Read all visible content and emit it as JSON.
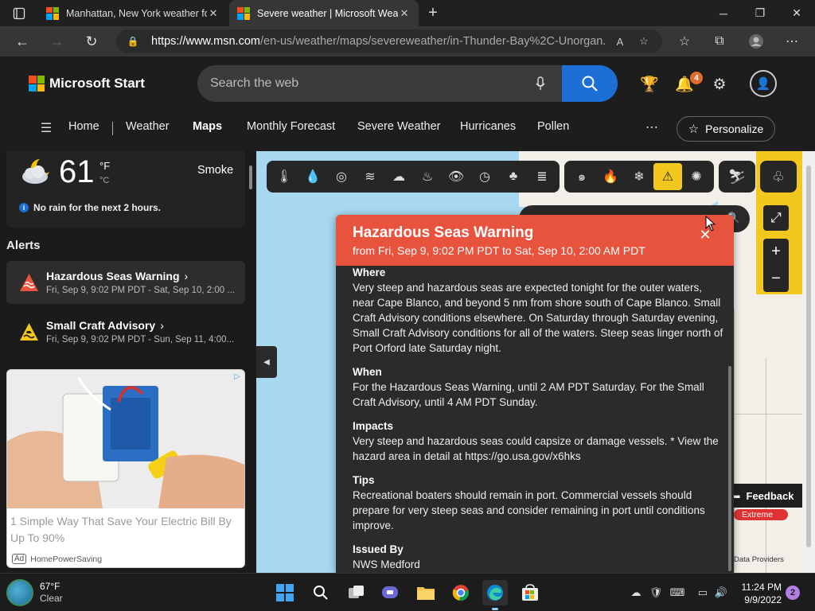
{
  "browser": {
    "tabs": [
      {
        "title": "Manhattan, New York weather fo",
        "active": false
      },
      {
        "title": "Severe weather | Microsoft Weat",
        "active": true
      }
    ],
    "url_host": "https://www.msn.com",
    "url_path": "/en-us/weather/maps/severeweather/in-Thunder-Bay%2C-Unorgan..."
  },
  "header": {
    "brand": "Microsoft Start",
    "search_placeholder": "Search the web",
    "notification_count": "4"
  },
  "nav": {
    "items": [
      "Home",
      "Weather",
      "Maps",
      "Monthly Forecast",
      "Severe Weather",
      "Hurricanes",
      "Pollen"
    ],
    "active": "Maps",
    "personalize_label": "Personalize"
  },
  "current": {
    "temperature": "61",
    "unit_f": "°F",
    "unit_c": "°C",
    "condition": "Smoke",
    "rain_note": "No rain for the next 2 hours."
  },
  "alerts": {
    "heading": "Alerts",
    "items": [
      {
        "title": "Hazardous Seas Warning",
        "time": "Fri, Sep 9, 9:02 PM PDT - Sat, Sep 10, 2:00 ...",
        "color": "#e8533d"
      },
      {
        "title": "Small Craft Advisory",
        "time": "Fri, Sep 9, 9:02 PM PDT - Sun, Sep 11, 4:00...",
        "color": "#f2c81f"
      }
    ]
  },
  "ad": {
    "title": "1 Simple Way That Save Your Electric Bill By Up To 90%",
    "badge": "Ad",
    "sponsor": "HomePowerSaving"
  },
  "popup": {
    "title": "Hazardous Seas Warning",
    "timeframe": "from Fri, Sep 9, 9:02 PM PDT to Sat, Sep 10, 2:00 AM PDT",
    "sections": [
      {
        "heading": "Where",
        "body": "Very steep and hazardous seas are expected tonight for the outer waters, near Cape Blanco, and beyond 5 nm from shore south of Cape Blanco. Small Craft Advisory conditions elsewhere. On Saturday through Saturday evening, Small Craft Advisory conditions for all of the waters. Steep seas linger north of Port Orford late Saturday night."
      },
      {
        "heading": "When",
        "body": "For the Hazardous Seas Warning, until 2 AM PDT Saturday. For the Small Craft Advisory, until 4 AM PDT Sunday."
      },
      {
        "heading": "Impacts",
        "body": "Very steep and hazardous seas could capsize or damage vessels. * View the hazard area in detail at https://go.usa.gov/x6hks"
      },
      {
        "heading": "Tips",
        "body": "Recreational boaters should remain in port. Commercial vessels should prepare for very steep seas and consider remaining in port until conditions improve."
      },
      {
        "heading": "Issued By",
        "body": "NWS Medford"
      }
    ]
  },
  "map": {
    "feedback_label": "Feedback",
    "legend_extreme": "Extreme",
    "data_providers": "Data Providers",
    "layers": [
      "thermometer-icon",
      "precipitation-icon",
      "radar-icon",
      "wind-icon",
      "cloud-icon",
      "humidity-icon",
      "visibility-icon",
      "pressure-icon",
      "pollen-icon",
      "air-quality-icon",
      "hurricane-icon",
      "wildfire-icon",
      "winter-icon",
      "severe-weather-icon",
      "earthquake-icon"
    ],
    "active_layer": "severe-weather-icon"
  },
  "taskbar": {
    "temp": "67°F",
    "condition": "Clear",
    "time": "11:24 PM",
    "date": "9/9/2022",
    "notification_count": "2"
  },
  "colors": {
    "accent": "#1d6fd6",
    "warning_red": "#e8533d",
    "advisory_yellow": "#f2c81f"
  }
}
